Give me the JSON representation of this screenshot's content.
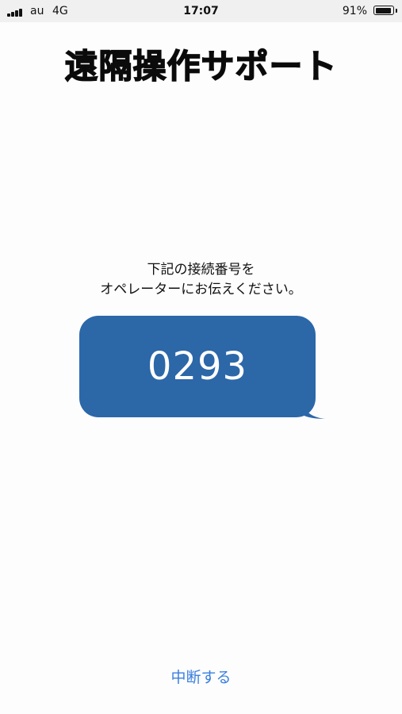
{
  "status_bar": {
    "carrier": "au",
    "network": "4G",
    "time": "17:07",
    "battery_percent": "91%",
    "battery_level": 0.91
  },
  "title": "遠隔操作サポート",
  "instruction": {
    "line1": "下記の接続番号を",
    "line2": "オペレーターにお伝えください。"
  },
  "connection_code": "0293",
  "cancel_label": "中断する",
  "colors": {
    "bubble": "#2c67a8",
    "link": "#3b7fe0"
  }
}
